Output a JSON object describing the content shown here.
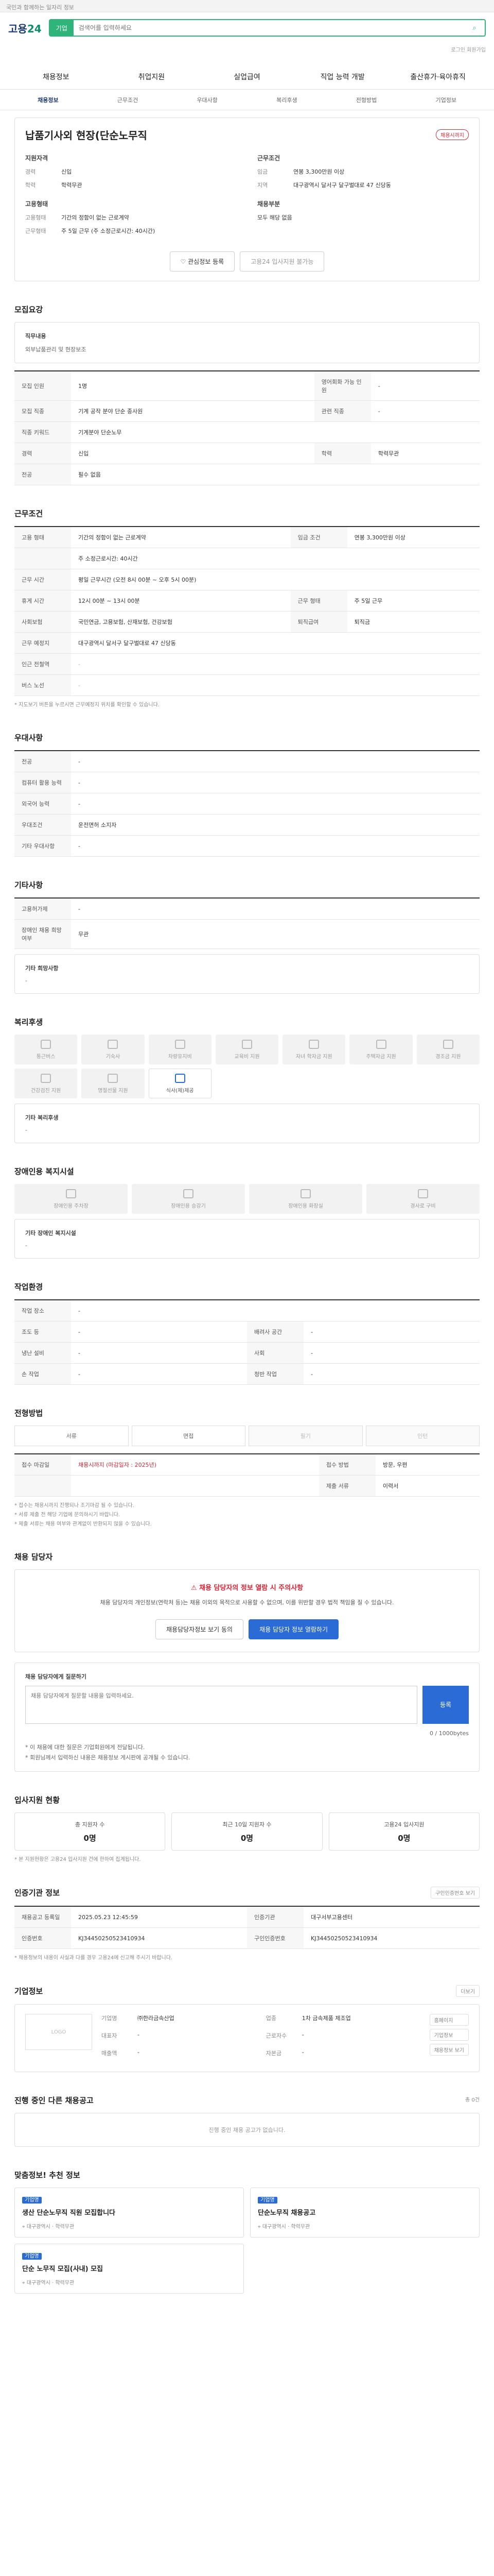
{
  "topbar": {
    "notice": "국민과 함께하는 일자리 정보"
  },
  "header": {
    "logo_prefix": "고용",
    "logo_suffix": "24",
    "search_tag": "기업",
    "search_placeholder": "검색어를 입력하세요"
  },
  "util": {
    "text": "로그인 회원가입"
  },
  "gnb": [
    "채용정보",
    "취업지원",
    "실업급여",
    "직업 능력 개발",
    "출산휴가·육아휴직"
  ],
  "subnav": [
    "채용정보",
    "근무조건",
    "우대사항",
    "복리후생",
    "전형방법",
    "기업정보"
  ],
  "job": {
    "title": "납품기사외 현장(단순노무직",
    "badge": "채용시까지",
    "left_head": "지원자격",
    "left": [
      [
        "경력",
        "신입"
      ],
      [
        "학력",
        "학력무관"
      ]
    ],
    "right_head": "근무조건",
    "right": [
      [
        "임금",
        "연봉 3,300만원 이상"
      ],
      [
        "지역",
        "대구광역시 달서구 달구벌대로 47 신당동"
      ]
    ],
    "left2_head": "고용형태",
    "left2": [
      [
        "고용형태",
        "기간의 정함이 없는 근로계약"
      ],
      [
        "근무형태",
        "주 5일 근무 (주 소정근로시간: 40시간)"
      ]
    ],
    "right2_head": "채용부분",
    "right2": [
      [
        "",
        "모두 해당 없음"
      ]
    ],
    "apply_label": "관심정보 등록",
    "share_label": "고용24 입사지원 불가능"
  },
  "recruit": {
    "title": "모집요강",
    "duty_head": "직무내용",
    "duty": "외부납품관리 및 현장보조",
    "rows": [
      [
        "모집 인원",
        "1명",
        "영어회화 가능 인원",
        "-"
      ],
      [
        "모집 직종",
        "기계 공작 분야 단순 종사원",
        "관련 직종",
        "-"
      ],
      [
        "직종 키워드",
        "기계분야 단순노무",
        "",
        ""
      ],
      [
        "경력",
        "신입",
        "학력",
        "학력무관"
      ],
      [
        "전공",
        "필수 없음",
        "",
        ""
      ]
    ]
  },
  "conditions": {
    "title": "근무조건",
    "rows": [
      [
        "고용 형태",
        "기간의 정함이 없는 근로계약",
        "임금 조건",
        "연봉 3,300만원 이상"
      ],
      [
        "",
        "주 소정근로시간: 40시간",
        "",
        ""
      ],
      [
        "근무 시간",
        "평일 근무시간 (오전 8시 00분 ~ 오후 5시 00분)",
        "",
        ""
      ],
      [
        "휴게 시간",
        "12시 00분 ~ 13시 00분",
        "근무 형태",
        "주 5일 근무"
      ],
      [
        "사회보험",
        "국민연금, 고용보험, 산재보험, 건강보험",
        "퇴직급여",
        "퇴직금"
      ],
      [
        "근무 예정지",
        "대구광역시 달서구 달구벌대로 47 신당동",
        "",
        ""
      ],
      [
        "인근 전철역",
        "-",
        "",
        ""
      ],
      [
        "버스 노선",
        "-",
        "",
        ""
      ]
    ],
    "note": "* 지도보기 버튼을 누르시면 근무예정지 위치를 확인할 수 있습니다."
  },
  "preference": {
    "title": "우대사항",
    "rows": [
      [
        "전공",
        "-"
      ],
      [
        "컴퓨터 활용 능력",
        "-"
      ],
      [
        "외국어 능력",
        "-"
      ],
      [
        "우대조건",
        "운전면허 소지자"
      ],
      [
        "기타 우대사항",
        "-"
      ]
    ]
  },
  "etc": {
    "title": "기타사항",
    "rows": [
      [
        "고용허가제",
        "-"
      ],
      [
        "장애인 채용 희망 여부",
        "무관"
      ]
    ],
    "sub_head": "기타 희망사항",
    "sub_value": "-"
  },
  "benefits": {
    "title": "복리후생",
    "items": [
      "통근버스",
      "기숙사",
      "차량유지비",
      "교육비 지원",
      "자녀 학자금 지원",
      "주택자금 지원",
      "경조금 지원",
      "건강검진 지원",
      "명절선물 지원",
      "식사(제)제공"
    ],
    "active": [
      9
    ],
    "etc_head": "기타 복리후생",
    "etc_value": "-"
  },
  "disability": {
    "title": "장애인용 복지시설",
    "items": [
      "장애인용 주차장",
      "장애인용 승강기",
      "장애인용 화장실",
      "경사로 구비"
    ],
    "etc_head": "기타 장애인 복지시설",
    "etc_value": "-"
  },
  "env": {
    "title": "작업환경",
    "rows": [
      [
        "작업 장소",
        "-",
        "",
        ""
      ],
      [
        "조도 등",
        "-",
        "배려사 공간",
        "-"
      ],
      [
        "냉난 설비",
        "-",
        "사회",
        "-"
      ],
      [
        "손 작업",
        "-",
        "청반 작업",
        "-"
      ]
    ]
  },
  "process": {
    "title": "전형방법",
    "steps": [
      "서류",
      "면접",
      "필기",
      "인턴"
    ],
    "rows": [
      [
        "접수 마감일",
        "채용시까지 (마감일자 : 2025년)",
        "접수 방법",
        "방문, 우편"
      ]
    ],
    "docs_head": "제출 서류",
    "docs": "이력서",
    "notes": [
      "* 접수는 채용시까지 진행되나 조기마감 될 수 있습니다.",
      "* 서류 제출 전 해당 기업에 문의하시기 바랍니다.",
      "* 제출 서류는 채용 여부와 관계없이 반환되지 않을 수 있습니다."
    ]
  },
  "warning": {
    "title": "채용 담당자",
    "warn": "채용 담당자의 정보 열람 시 주의사항",
    "body": "채용 담당자의 개인정보(연락처 등)는 채용 이외의 목적으로 사용할 수 없으며, 이를 위반할 경우 법적 책임을 질 수 있습니다.",
    "btn1": "채용담당자정보 보기 동의",
    "btn2": "채용 담당자 정보 열람하기"
  },
  "qa": {
    "title": "채용 담당자에게 질문하기",
    "placeholder": "채용 담당자에게 질문할 내용을 입력하세요.",
    "counter": "0 / 1000bytes",
    "submit": "등록",
    "notes": [
      "* 이 채용에 대한 질문은 기업회원에게 전달됩니다.",
      "* 회원님께서 입력하신 내용은 채용정보 게시판에 공개될 수 있습니다."
    ]
  },
  "status": {
    "title": "입사지원 현황",
    "items": [
      [
        "총 지원자 수",
        "0명"
      ],
      [
        "최근 10일 지원자 수",
        "0명"
      ],
      [
        "고용24 입사지원",
        "0명"
      ]
    ],
    "note": "* 본 지원현황은 고용24 입사지원 건에 한하여 집계됩니다."
  },
  "meta": {
    "title": "인증기관 정보",
    "btn": "구인인증번호 보기",
    "rows": [
      [
        "채용공고 등록일",
        "2025.05.23 12:45:59",
        "인증기관",
        "대구서부고용센터"
      ],
      [
        "인증번호",
        "KJ34450250523410934",
        "구인인증번호",
        "KJ34450250523410934"
      ]
    ],
    "note": "* 채용정보의 내용이 사실과 다를 경우 고용24에 신고해 주시기 바랍니다."
  },
  "company": {
    "title": "기업정보",
    "more": "더보기",
    "logo": "LOGO",
    "rows": [
      [
        "기업명",
        "㈜한라금속산업",
        "업종",
        "1차 금속제품 제조업"
      ],
      [
        "대표자",
        "-",
        "근로자수",
        "-"
      ],
      [
        "매출액",
        "-",
        "자본금",
        "-"
      ]
    ],
    "links": [
      "홈페이지",
      "기업정보",
      "채용정보 보기"
    ]
  },
  "others": {
    "title": "진행 중인 다른 채용공고",
    "count": "총 0건",
    "empty": "진행 중인 채용 공고가 없습니다."
  },
  "recommend": {
    "title": "맞춤정보! 추천 정보",
    "items": [
      [
        "기업명",
        "생산 단순노무직 직원 모집합니다",
        "대구광역시",
        "학력무관"
      ],
      [
        "기업명",
        "단순노무직 채용공고",
        "대구광역시",
        "학력무관"
      ],
      [
        "기업명",
        "단순 노무직 모집(사내) 모집",
        "대구광역시",
        "학력무관"
      ]
    ]
  }
}
